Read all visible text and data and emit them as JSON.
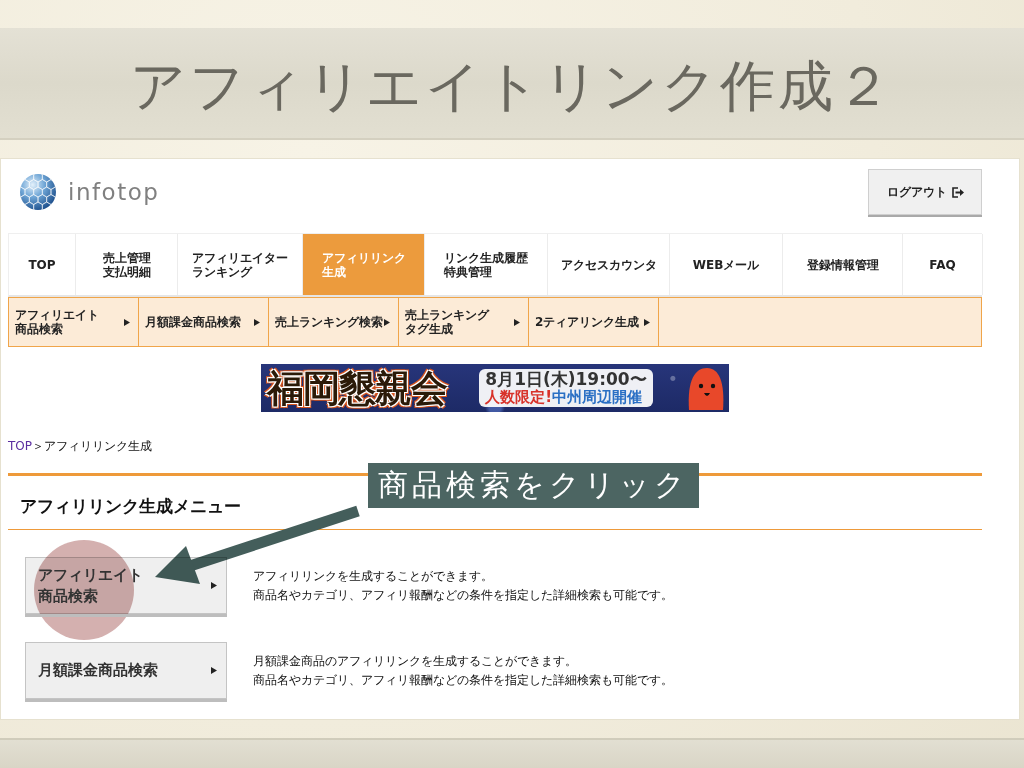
{
  "slide": {
    "title": "アフィリエイトリンク作成２"
  },
  "header": {
    "logo_text": "infotop",
    "logout_button": "ログアウト"
  },
  "main_nav": [
    {
      "lines": [
        "TOP"
      ],
      "selected": false
    },
    {
      "lines": [
        "売上管理",
        "支払明細"
      ],
      "selected": false
    },
    {
      "lines": [
        "アフィリエイター",
        "ランキング"
      ],
      "selected": false
    },
    {
      "lines": [
        "アフィリリンク",
        "生成"
      ],
      "selected": true
    },
    {
      "lines": [
        "リンク生成履歴",
        "特典管理"
      ],
      "selected": false
    },
    {
      "lines": [
        "アクセスカウンタ"
      ],
      "selected": false
    },
    {
      "lines": [
        "WEBメール"
      ],
      "selected": false
    },
    {
      "lines": [
        "登録情報管理"
      ],
      "selected": false
    },
    {
      "lines": [
        "FAQ"
      ],
      "selected": false
    }
  ],
  "sub_nav": [
    {
      "lines": [
        "アフィリエイト",
        "商品検索"
      ]
    },
    {
      "lines": [
        "月額課金商品検索"
      ]
    },
    {
      "lines": [
        "売上ランキング検索"
      ]
    },
    {
      "lines": [
        "売上ランキング",
        "タグ生成"
      ]
    },
    {
      "lines": [
        "2ティアリンク生成"
      ]
    }
  ],
  "banner": {
    "title": "福岡懇親会",
    "date": "8月1日(木)19:00〜",
    "limit": "人数限定!",
    "venue": "中州周辺開催"
  },
  "breadcrumb": {
    "link": "TOP",
    "separator": "＞",
    "current": "アフィリリンク生成"
  },
  "menu": {
    "heading": "アフィリリンク生成メニュー",
    "items": [
      {
        "lines": [
          "アフィリエイト",
          "商品検索"
        ],
        "description": [
          "アフィリリンクを生成することができます。",
          "商品名やカテゴリ、アフィリ報酬などの条件を指定した詳細検索も可能です。"
        ]
      },
      {
        "lines": [
          "月額課金商品検索"
        ],
        "description": [
          "月額課金商品のアフィリリンクを生成することができます。",
          "商品名やカテゴリ、アフィリ報酬などの条件を指定した詳細検索も可能です。"
        ]
      }
    ]
  },
  "annotation": {
    "text": "商品検索をクリック"
  }
}
